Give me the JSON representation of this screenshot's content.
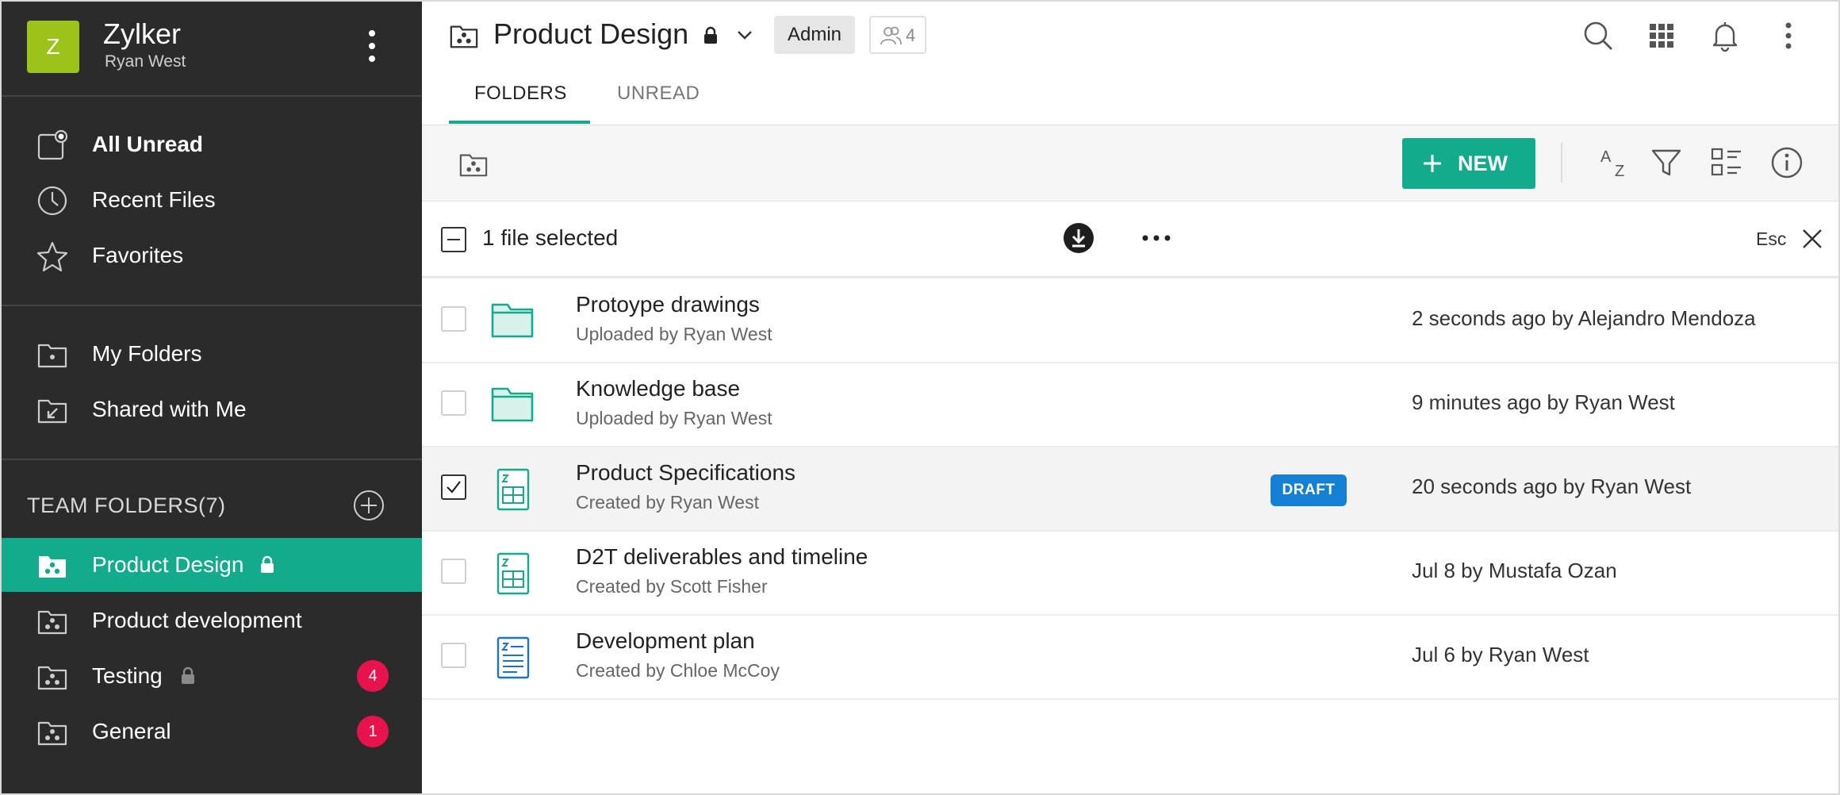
{
  "org": {
    "logo_letter": "Z",
    "name": "Zylker",
    "user": "Ryan West"
  },
  "sidebar": {
    "quick": [
      {
        "label": "All Unread"
      },
      {
        "label": "Recent Files"
      },
      {
        "label": "Favorites"
      }
    ],
    "folders": [
      {
        "label": "My Folders"
      },
      {
        "label": "Shared with Me"
      }
    ],
    "team_folders_heading": "TEAM FOLDERS(7)",
    "teams": [
      {
        "label": "Product Design",
        "locked": true,
        "active": true
      },
      {
        "label": "Product development"
      },
      {
        "label": "Testing",
        "locked": true,
        "badge": "4"
      },
      {
        "label": "General",
        "badge": "1"
      }
    ]
  },
  "header": {
    "title": "Product Design",
    "role": "Admin",
    "member_count": "4",
    "tabs": [
      {
        "label": "FOLDERS",
        "active": true
      },
      {
        "label": "UNREAD"
      }
    ]
  },
  "toolbar": {
    "new_label": "NEW"
  },
  "selection": {
    "text": "1 file selected",
    "esc_label": "Esc"
  },
  "files": [
    {
      "name": "Protoype drawings",
      "sub": "Uploaded by Ryan West",
      "modified": "2 seconds ago by Alejandro Mendoza",
      "type": "folder-icon"
    },
    {
      "name": "Knowledge base",
      "sub": "Uploaded by Ryan West",
      "modified": "9 minutes ago by Ryan West",
      "type": "folder-icon"
    },
    {
      "name": "Product Specifications",
      "sub": "Created by Ryan West",
      "modified": "20 seconds ago by Ryan West",
      "type": "spreadsheet-icon",
      "badge": "DRAFT",
      "selected": true
    },
    {
      "name": "D2T deliverables and timeline",
      "sub": "Created by Scott Fisher",
      "modified": "Jul 8 by Mustafa Ozan",
      "type": "spreadsheet-icon"
    },
    {
      "name": "Development plan",
      "sub": "Created by Chloe McCoy",
      "modified": "Jul 6 by Ryan West",
      "type": "document-icon"
    }
  ],
  "colors": {
    "accent": "#12ab8c",
    "sidebar_bg": "#2b2b2b",
    "badge": "#e8134d",
    "draft": "#1380d6",
    "logo": "#9cc31a"
  }
}
